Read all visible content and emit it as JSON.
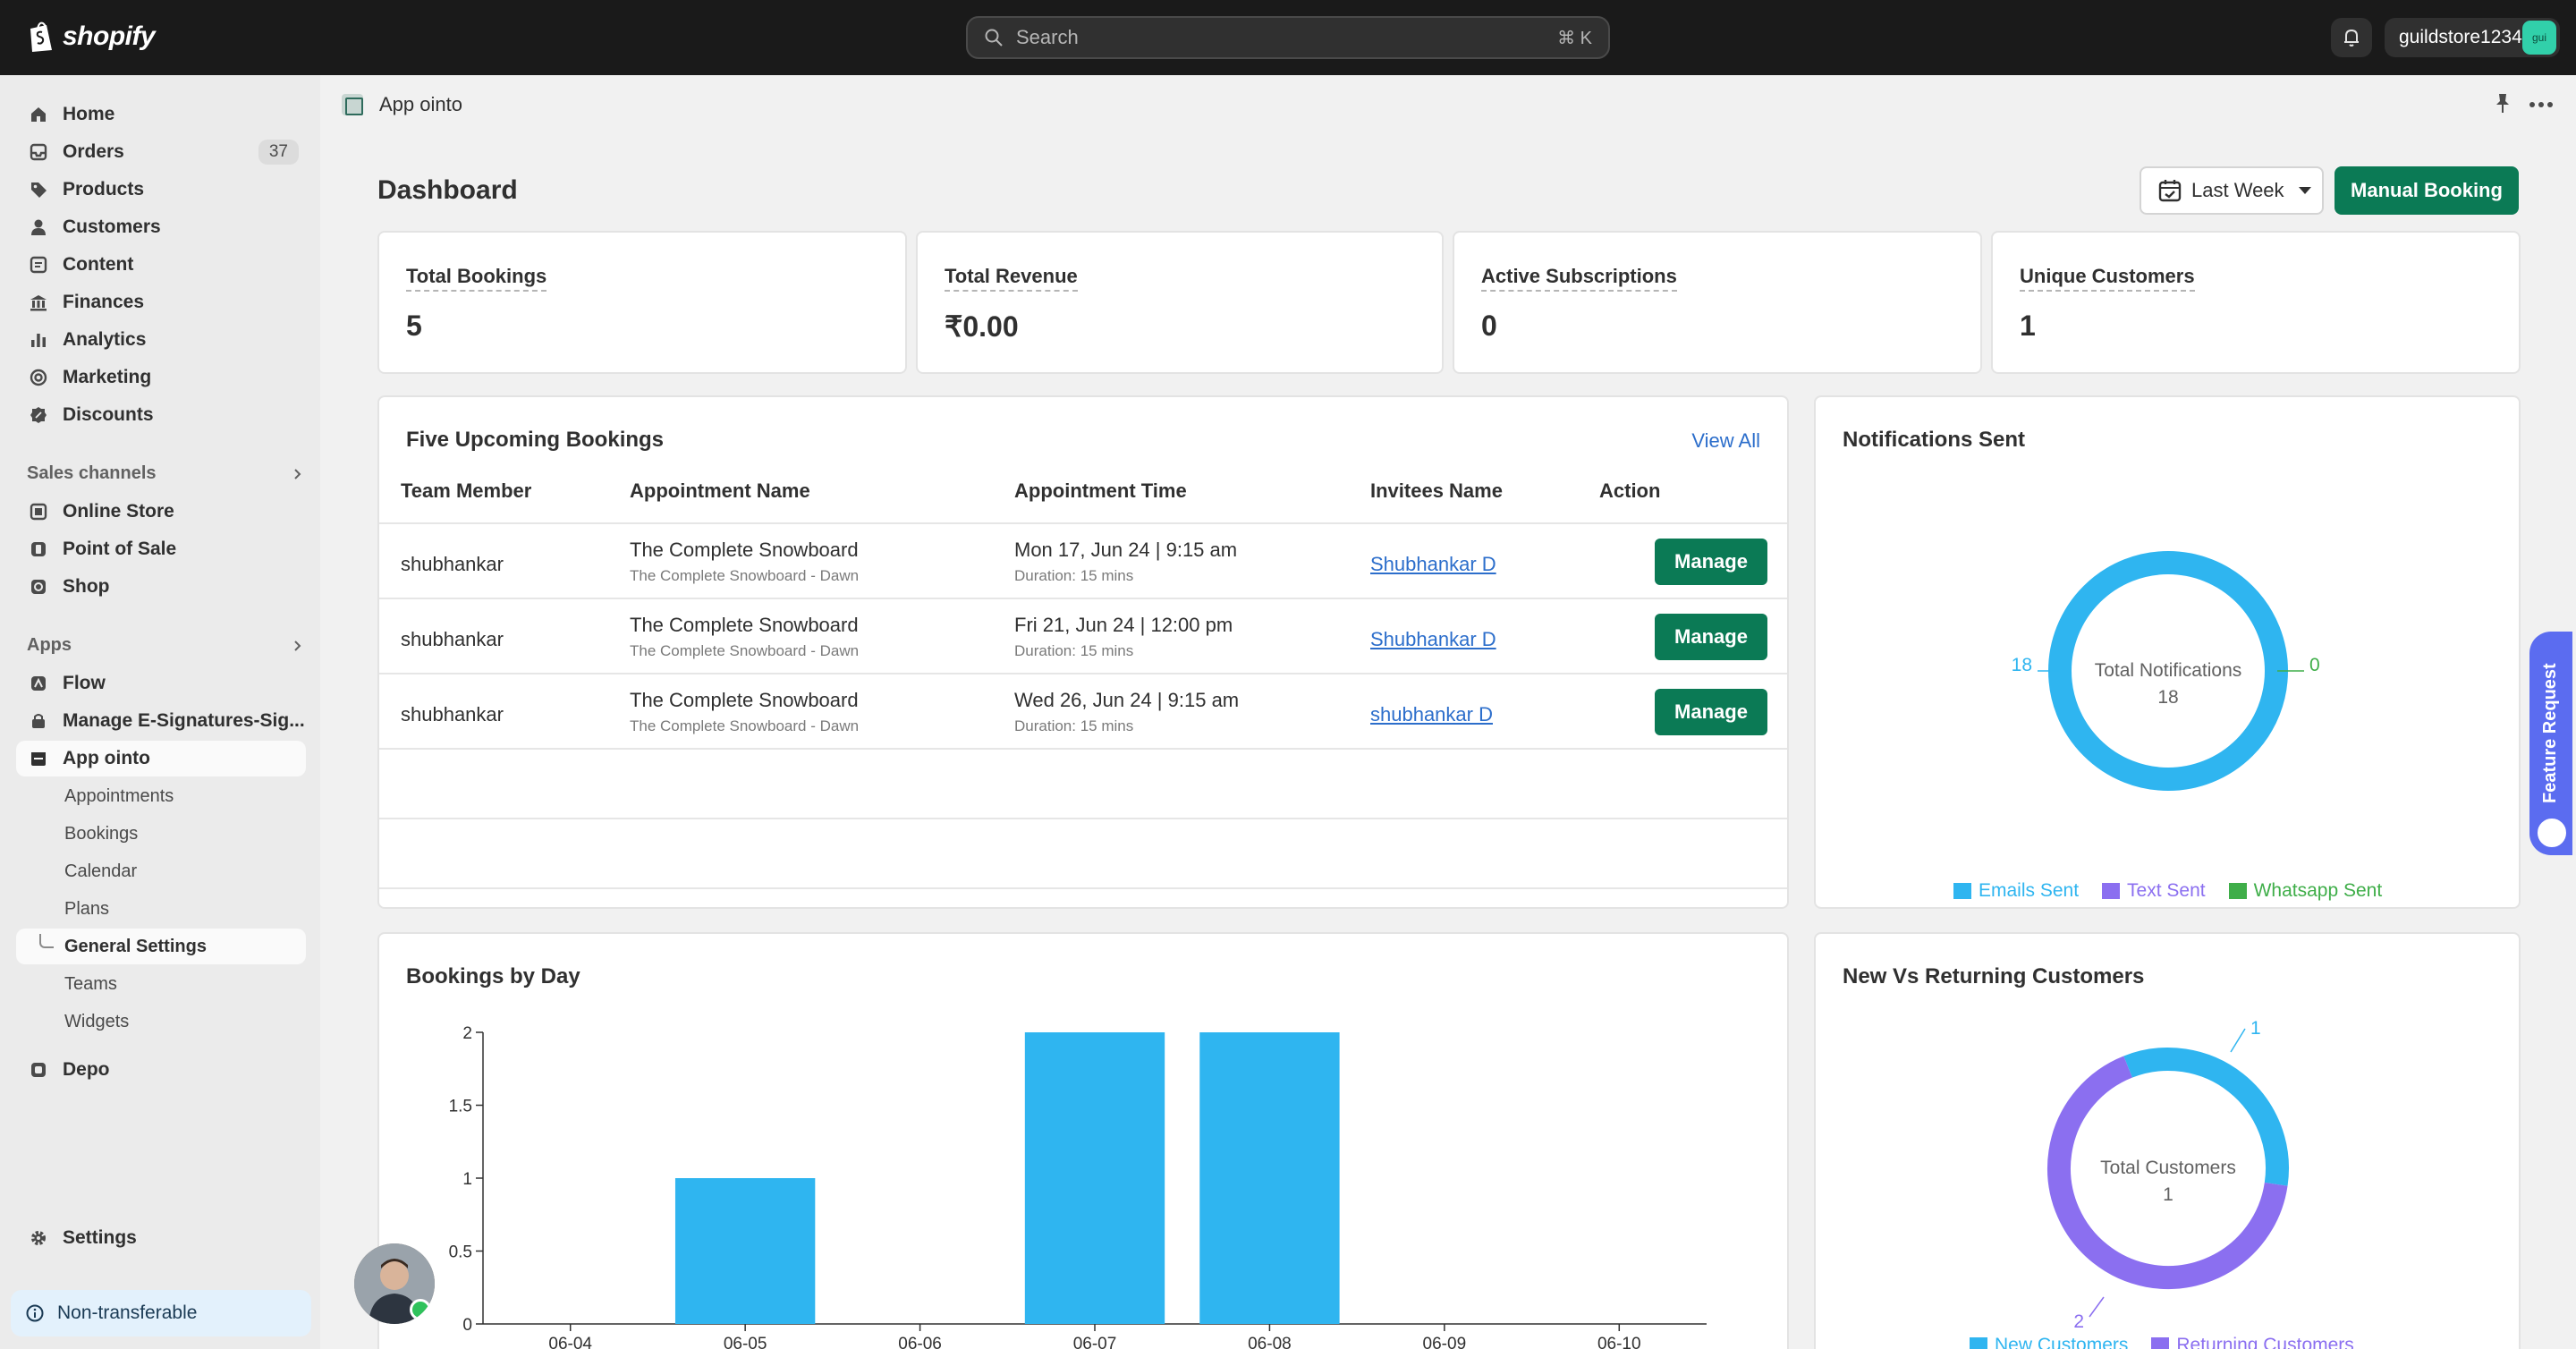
{
  "topbar": {
    "logo_text": "shopify",
    "search_placeholder": "Search",
    "search_shortcut": "⌘ K",
    "store_name": "guildstore1234",
    "store_avatar": "gui"
  },
  "sidebar": {
    "main_items": [
      {
        "label": "Home",
        "icon": "home-icon"
      },
      {
        "label": "Orders",
        "icon": "orders-icon",
        "badge": "37"
      },
      {
        "label": "Products",
        "icon": "tag-icon"
      },
      {
        "label": "Customers",
        "icon": "person-icon"
      },
      {
        "label": "Content",
        "icon": "content-icon"
      },
      {
        "label": "Finances",
        "icon": "bank-icon"
      },
      {
        "label": "Analytics",
        "icon": "analytics-icon"
      },
      {
        "label": "Marketing",
        "icon": "target-icon"
      },
      {
        "label": "Discounts",
        "icon": "discount-icon"
      }
    ],
    "sales_channels_label": "Sales channels",
    "sales_channels": [
      {
        "label": "Online Store"
      },
      {
        "label": "Point of Sale"
      },
      {
        "label": "Shop"
      }
    ],
    "apps_label": "Apps",
    "apps": [
      {
        "label": "Flow"
      },
      {
        "label": "Manage E-Signatures-Sig..."
      },
      {
        "label": "App ointo"
      }
    ],
    "app_sub_items": [
      "Appointments",
      "Bookings",
      "Calendar",
      "Plans",
      "General Settings",
      "Teams",
      "Widgets"
    ],
    "depo_label": "Depo",
    "settings_label": "Settings",
    "non_transferable_label": "Non-transferable"
  },
  "appbar": {
    "title": "App ointo"
  },
  "dashboard": {
    "title": "Dashboard",
    "range_label": "Last Week",
    "manual_booking_label": "Manual Booking",
    "stats": [
      {
        "label": "Total Bookings",
        "value": "5"
      },
      {
        "label": "Total Revenue",
        "value": "₹0.00"
      },
      {
        "label": "Active Subscriptions",
        "value": "0"
      },
      {
        "label": "Unique Customers",
        "value": "1"
      }
    ]
  },
  "upcoming": {
    "title": "Five Upcoming Bookings",
    "view_all": "View All",
    "columns": [
      "Team Member",
      "Appointment Name",
      "Appointment Time",
      "Invitees Name",
      "Action"
    ],
    "rows": [
      {
        "member": "shubhankar",
        "name": "The Complete Snowboard",
        "name_sub": "The Complete Snowboard - Dawn",
        "time": "Mon 17, Jun 24 | 9:15 am",
        "duration": "Duration: 15 mins",
        "invitee": "Shubhankar D",
        "action": "Manage"
      },
      {
        "member": "shubhankar",
        "name": "The Complete Snowboard",
        "name_sub": "The Complete Snowboard - Dawn",
        "time": "Fri 21, Jun 24 | 12:00 pm",
        "duration": "Duration: 15 mins",
        "invitee": "Shubhankar D",
        "action": "Manage"
      },
      {
        "member": "shubhankar",
        "name": "The Complete Snowboard",
        "name_sub": "The Complete Snowboard - Dawn",
        "time": "Wed 26, Jun 24 | 9:15 am",
        "duration": "Duration: 15 mins",
        "invitee": "shubhankar D",
        "action": "Manage"
      }
    ]
  },
  "notifications": {
    "title": "Notifications Sent",
    "center_label": "Total Notifications",
    "center_value": "18",
    "left_callout": "18",
    "right_callout": "0",
    "legend": [
      {
        "label": "Emails Sent",
        "color": "#2fb5f0"
      },
      {
        "label": "Text Sent",
        "color": "#8b6ff0"
      },
      {
        "label": "Whatsapp Sent",
        "color": "#3fae49"
      }
    ]
  },
  "bookings_by_day": {
    "title": "Bookings by Day"
  },
  "new_vs_returning": {
    "title": "New Vs Returning Customers",
    "center_label": "Total Customers",
    "center_value": "1",
    "top_callout": "1",
    "bottom_callout": "2",
    "legend": [
      {
        "label": "New Customers",
        "color": "#2fb5f0"
      },
      {
        "label": "Returning Customers",
        "color": "#8b6ff0"
      }
    ]
  },
  "feature_request": "Feature Request",
  "chart_data": [
    {
      "type": "bar",
      "title": "Bookings by Day",
      "categories": [
        "06-04",
        "06-05",
        "06-06",
        "06-07",
        "06-08",
        "06-09",
        "06-10"
      ],
      "values": [
        0,
        1,
        0,
        2,
        2,
        0,
        0
      ],
      "yticks": [
        "0",
        "0.5",
        "1",
        "1.5",
        "2"
      ],
      "ylim": [
        0,
        2
      ],
      "color": "#2fb5f0"
    },
    {
      "type": "pie",
      "title": "Notifications Sent",
      "labels": [
        "Emails Sent",
        "Text Sent",
        "Whatsapp Sent"
      ],
      "values": [
        18,
        0,
        0
      ]
    },
    {
      "type": "pie",
      "title": "New Vs Returning Customers",
      "labels": [
        "New Customers",
        "Returning Customers"
      ],
      "values": [
        1,
        2
      ]
    }
  ]
}
